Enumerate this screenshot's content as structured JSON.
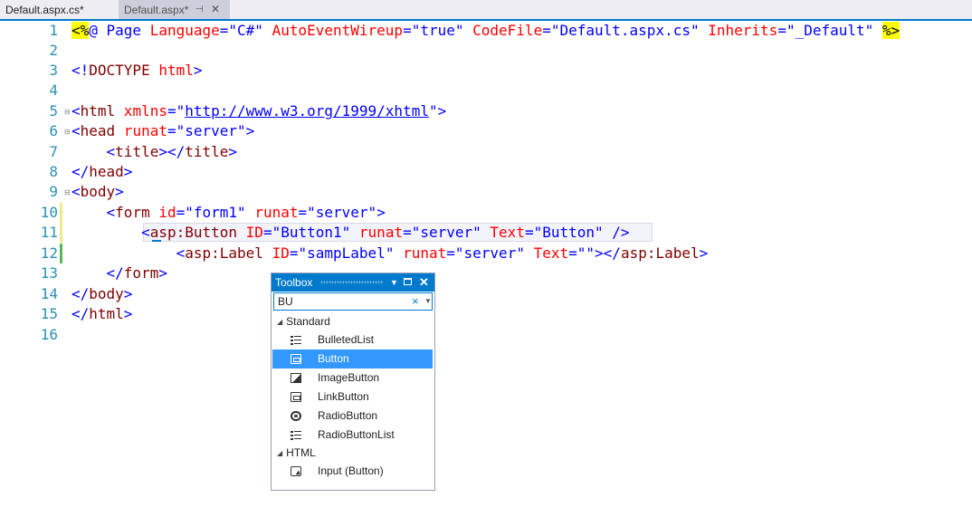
{
  "tabs": [
    {
      "label": "Default.aspx.cs*",
      "active": true
    },
    {
      "label": "Default.aspx*",
      "active": false
    }
  ],
  "editor": {
    "line_numbers": [
      "1",
      "2",
      "3",
      "4",
      "5",
      "6",
      "7",
      "8",
      "9",
      "10",
      "11",
      "12",
      "13",
      "14",
      "15",
      "16"
    ],
    "lines": {
      "l1": {
        "open": "<%",
        "at": "@ Page ",
        "attr1": "Language",
        "eq1": "=",
        "val1": "\"C#\"",
        "attr2": " AutoEventWireup",
        "eq2": "=",
        "val2": "\"true\"",
        "attr3": " CodeFile",
        "eq3": "=",
        "val3": "\"Default.aspx.cs\"",
        "attr4": " Inherits",
        "eq4": "=",
        "val4": "\"_Default\"",
        "close": "%>"
      },
      "l3": {
        "lt": "<!",
        "tag": "DOCTYPE",
        "rest": " html",
        "gt": ">"
      },
      "l5": {
        "lt": "<",
        "tag": "html",
        "attr": " xmlns",
        "eq": "=\"",
        "url": "http://www.w3.org/1999/xhtml",
        "q": "\"",
        "gt": ">"
      },
      "l6": {
        "lt": "<",
        "tag": "head",
        "attr": " runat",
        "eq": "=",
        "val": "\"server\"",
        "gt": ">"
      },
      "l7": {
        "indent": "    ",
        "open": "<",
        "tag": "title",
        "mid": "></",
        "tag2": "title",
        "gt": ">"
      },
      "l8": {
        "lt": "</",
        "tag": "head",
        "gt": ">"
      },
      "l9": {
        "lt": "<",
        "tag": "body",
        "gt": ">"
      },
      "l10": {
        "indent": "    ",
        "lt": "<",
        "tag": "form",
        "attr1": " id",
        "eq1": "=",
        "val1": "\"form1\"",
        "attr2": " runat",
        "eq2": "=",
        "val2": "\"server\"",
        "gt": ">"
      },
      "l11": {
        "indent": "        ",
        "lt": "<",
        "tag": "asp:Button",
        "attr1": " ID",
        "eq1": "=",
        "val1": "\"Button1\"",
        "attr2": " runat",
        "eq2": "=",
        "val2": "\"server\"",
        "attr3": " Text",
        "eq3": "=",
        "val3": "\"Button\"",
        "end": " />"
      },
      "l12": {
        "indent": "            ",
        "lt": "<",
        "tag": "asp:Label",
        "attr1": " ID",
        "eq1": "=",
        "val1": "\"sampLabel\"",
        "attr2": " runat",
        "eq2": "=",
        "val2": "\"server\"",
        "attr3": " Text",
        "eq3": "=",
        "val3": "\"\"",
        "mid": "></",
        "tag2": "asp:Label",
        "gt": ">"
      },
      "l13": {
        "indent": "    ",
        "lt": "</",
        "tag": "form",
        "gt": ">"
      },
      "l14": {
        "lt": "</",
        "tag": "body",
        "gt": ">"
      },
      "l15": {
        "lt": "</",
        "tag": "html",
        "gt": ">"
      }
    }
  },
  "toolbox": {
    "title": "Toolbox",
    "search_value": "BU",
    "clear_icon": "×",
    "categories": [
      {
        "label": "Standard",
        "items": [
          {
            "label": "BulletedList",
            "icon": "bulleted-list-icon"
          },
          {
            "label": "Button",
            "icon": "button-icon",
            "selected": true
          },
          {
            "label": "ImageButton",
            "icon": "image-button-icon"
          },
          {
            "label": "LinkButton",
            "icon": "link-button-icon"
          },
          {
            "label": "RadioButton",
            "icon": "radio-button-icon"
          },
          {
            "label": "RadioButtonList",
            "icon": "radio-button-list-icon"
          }
        ]
      },
      {
        "label": "HTML",
        "items": [
          {
            "label": "Input (Button)",
            "icon": "input-button-icon"
          }
        ]
      }
    ]
  },
  "colors": {
    "accent": "#007acc",
    "selection": "#3399ff",
    "line_number": "#2b91af",
    "tag": "#800000",
    "attribute": "#ff0000",
    "value": "#0000ff"
  }
}
